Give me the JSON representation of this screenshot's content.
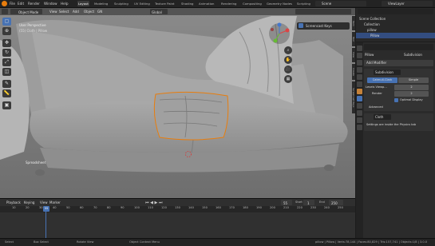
{
  "menubar": {
    "file": "File",
    "edit": "Edit",
    "render": "Render",
    "window": "Window",
    "help": "Help",
    "workspaces": [
      "Layout",
      "Modeling",
      "Sculpting",
      "UV Editing",
      "Texture Paint",
      "Shading",
      "Animation",
      "Rendering",
      "Compositing",
      "Geometry Nodes",
      "Scripting"
    ],
    "scene": "Scene",
    "view_layer": "ViewLayer"
  },
  "viewport": {
    "mode": "Object Mode",
    "menus": [
      "View",
      "Select",
      "Add",
      "Object",
      "GN"
    ],
    "transform": "Global",
    "overlay_title": "User Perspective",
    "overlay_sub": "(55) Cloth | Pillow",
    "object_label": "Spreadsheet",
    "popup": "Screencast Keys",
    "side_tabs": [
      "Item",
      "Tool",
      "View",
      "Create",
      "Screencast Keys"
    ]
  },
  "timeline": {
    "menus": [
      "Playback",
      "Keying",
      "View",
      "Marker"
    ],
    "current_frame": "55",
    "start_label": "Start",
    "start": "1",
    "end_label": "End",
    "end": "250",
    "ticks": [
      "10",
      "20",
      "30",
      "40",
      "50",
      "60",
      "70",
      "80",
      "90",
      "100",
      "110",
      "120",
      "130",
      "140",
      "150",
      "160",
      "170",
      "180",
      "190",
      "200",
      "210",
      "220",
      "230",
      "240",
      "250"
    ]
  },
  "status": {
    "select": "Select",
    "box_select": "Box Select",
    "rotate": "Rotate View",
    "context": "Object Context Menu",
    "stats": "pillow | Pillow | Verts:78,144 | Faces:80,829 | Tris:157,741 | Objects:1/8 | 3.0.0"
  },
  "outliner": {
    "search": "",
    "rows": [
      "Scene Collection",
      "Collection",
      "pillow",
      "Pillow"
    ]
  },
  "properties": {
    "object": "Pillow",
    "modifier": "Subdivision",
    "add_modifier": "Add Modifier",
    "mod_name": "Subdivision",
    "catmull": "Catmull-Clark",
    "simple": "Simple",
    "levels_viewport_label": "Levels Viewp...",
    "levels_viewport": "2",
    "render_label": "Render",
    "render": "2",
    "optimal": "Optimal Display",
    "advanced": "Advanced",
    "cloth": "Cloth",
    "cloth_note": "Settings are inside the Physics tab"
  },
  "colors": {
    "accent": "#4772b3",
    "selected_outline": "#e87d0d"
  }
}
